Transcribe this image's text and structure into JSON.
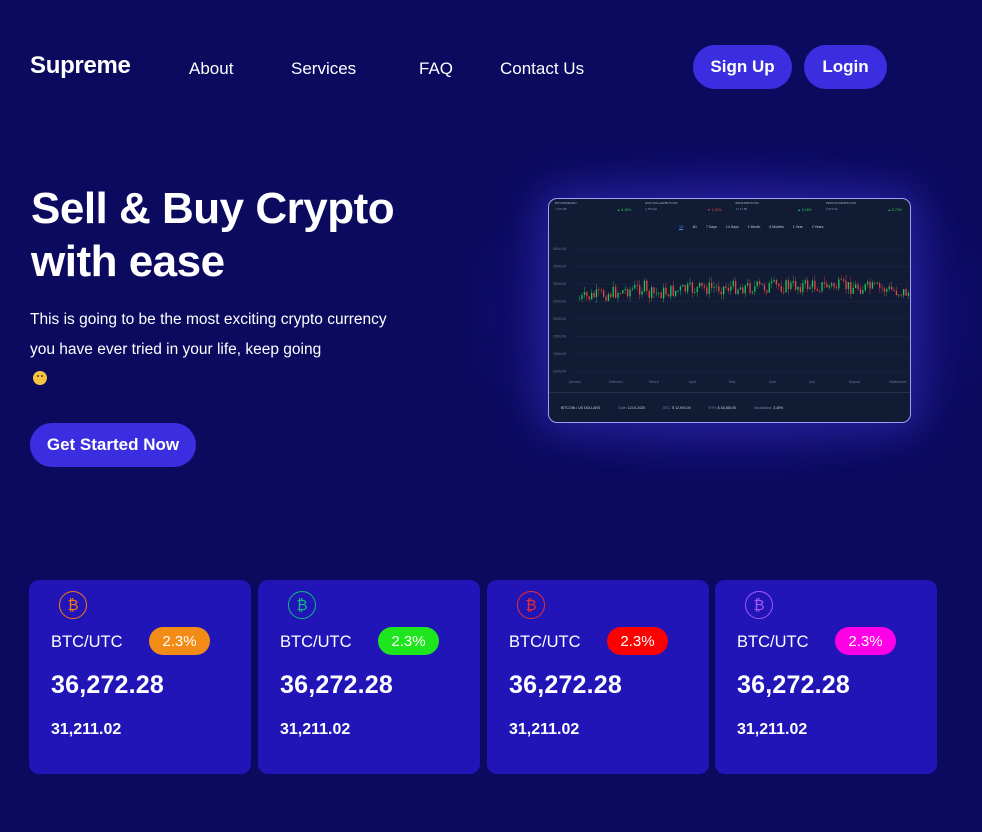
{
  "brand": {
    "logo": "Supreme"
  },
  "nav": {
    "links": [
      "About",
      "Services",
      "FAQ",
      "Contact Us"
    ],
    "signup_label": "Sign Up",
    "login_label": "Login"
  },
  "hero": {
    "title_line1": "Sell & Buy Crypto",
    "title_line2": "with ease",
    "subtitle_line1": "This is going to be the most exciting crypto currency",
    "subtitle_line2": "you have ever tried in your life, keep going",
    "cta_label": "Get Started Now"
  },
  "chart_panel": {
    "tickers": [
      {
        "name": "BITCOIN/EURO",
        "value": "7,171.85",
        "change": "▲ 6.18%",
        "color": "#22c55e"
      },
      {
        "name": "EUR-DOLLAR/BITCOIN",
        "value": "2,573.00",
        "change": "▼ 1.23%",
        "color": "#ef4444"
      },
      {
        "name": "BANKS/BITCOIN",
        "value": "7,171.85",
        "change": "▲ 6.18%",
        "color": "#22c55e"
      },
      {
        "name": "PROFOUND/BITCOIN",
        "value": "2,573.00",
        "change": "▲ 6.73%",
        "color": "#22c55e"
      }
    ],
    "ranges": [
      "1D",
      "4D",
      "7 Days",
      "14 Days",
      "1 Month",
      "6 Months",
      "1 Year",
      "2 Years"
    ],
    "active_range": "1D",
    "y_ticks": [
      "4000.00",
      "3500.00",
      "3000.00",
      "2500.00",
      "2000.00",
      "1500.00",
      "1000.00",
      "2500.00"
    ],
    "x_ticks": [
      "January",
      "February",
      "March",
      "April",
      "May",
      "June",
      "July",
      "August",
      "September"
    ],
    "footer": {
      "pair": "BITCOIN / US DOLLARS",
      "date_label": "Date:",
      "date": "12.01.2020",
      "btc_label": "BTC:",
      "btc_value": "$ 12,900.00",
      "eth_label": "ETH:",
      "eth_value": "$ 18,365.00",
      "mod_label": "Modulation:",
      "mod_value": "3.45%"
    }
  },
  "cards": [
    {
      "icon": "bitcoin-icon",
      "icon_color": "#f97316",
      "pair": "BTC/UTC",
      "change": "2.3%",
      "badge_color": "#f28c16",
      "price": "36,272.28",
      "sub_price": "31,211.02"
    },
    {
      "icon": "bitcoin-icon",
      "icon_color": "#10b981",
      "pair": "BTC/UTC",
      "change": "2.3%",
      "badge_color": "#1ee61e",
      "price": "36,272.28",
      "sub_price": "31,211.02"
    },
    {
      "icon": "bitcoin-icon",
      "icon_color": "#ef2b2b",
      "pair": "BTC/UTC",
      "change": "2.3%",
      "badge_color": "#ff0000",
      "price": "36,272.28",
      "sub_price": "31,211.02"
    },
    {
      "icon": "bitcoin-icon",
      "icon_color": "#a855f7",
      "pair": "BTC/UTC",
      "change": "2.3%",
      "badge_color": "#ff00e6",
      "price": "36,272.28",
      "sub_price": "31,211.02"
    }
  ],
  "colors": {
    "background": "#0b0a5f",
    "accent": "#3b2ee0",
    "card": "#2215b8",
    "candle_up": "#22c55e",
    "candle_down": "#ef4444"
  }
}
